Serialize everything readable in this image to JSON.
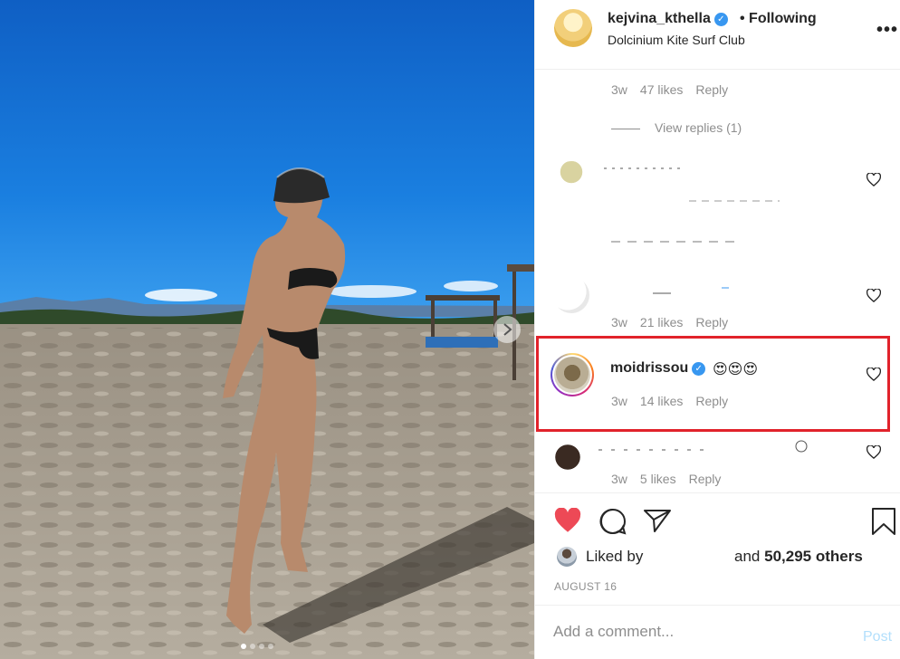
{
  "post": {
    "photo_alt": "beach photo",
    "carousel_dots": 4,
    "active_dot": 0
  },
  "header": {
    "username": "kejvina_kthella",
    "follow_label": "• Following",
    "location": "Dolcinium Kite Surf Club",
    "more_label": "•••"
  },
  "comments": [
    {
      "age": "3w",
      "likes": "47 likes",
      "reply_label": "Reply"
    },
    {
      "view_replies": "View replies (1)"
    },
    {
      "age": "3w",
      "likes": "21 likes",
      "reply_label": "Reply"
    },
    {
      "username": "moidrissou",
      "text": "😍😍😍",
      "age": "3w",
      "likes": "14 likes",
      "reply_label": "Reply"
    },
    {
      "age": "3w",
      "likes": "5 likes",
      "reply_label": "Reply"
    }
  ],
  "actions": {
    "liked_by": "Liked by",
    "and_label": "and",
    "others": "50,295 others",
    "date": "AUGUST 16"
  },
  "add_comment": {
    "placeholder": "Add a comment...",
    "post_label": "Post"
  },
  "colors": {
    "heart_liked": "#ed4956",
    "verified": "#3897f0",
    "highlight": "#e1222b",
    "post_button": "#b2dffc"
  }
}
